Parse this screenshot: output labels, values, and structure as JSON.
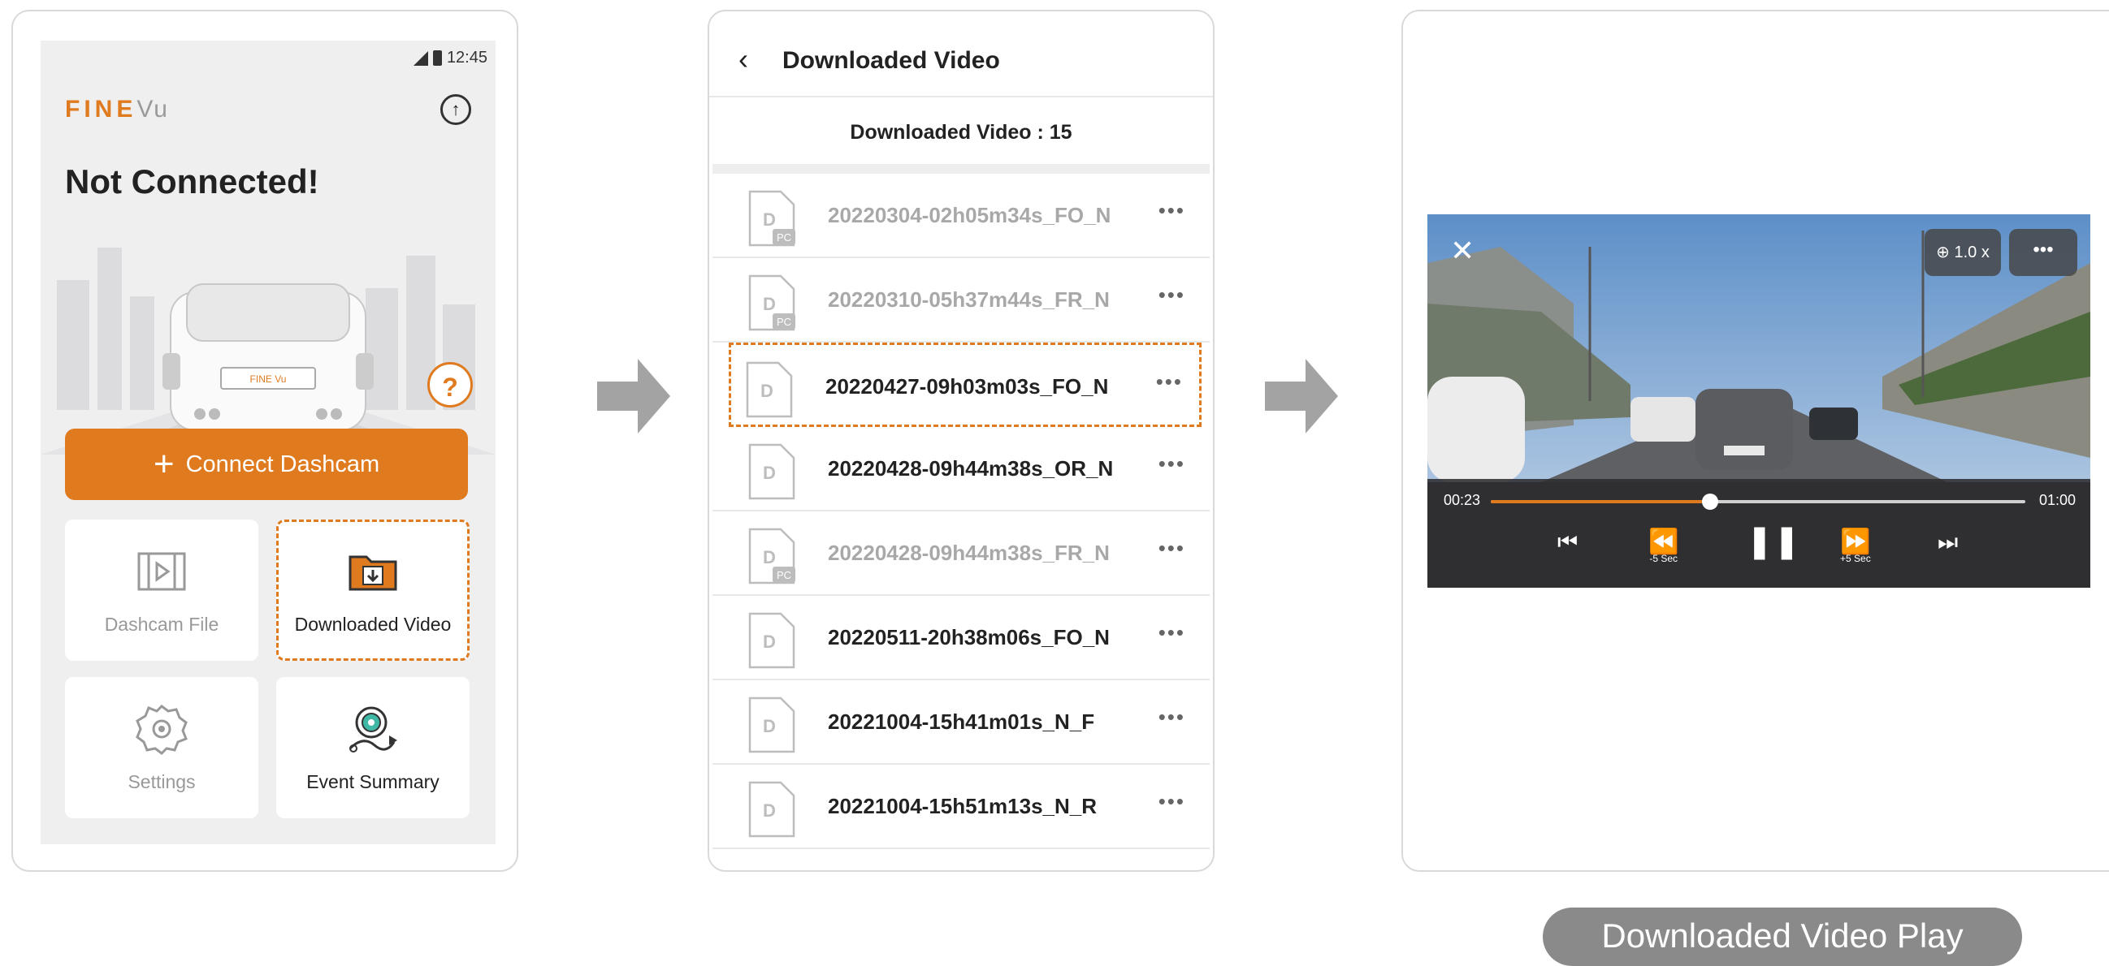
{
  "home": {
    "status_time": "12:45",
    "logo_fine": "FINE",
    "logo_vu": "Vu",
    "heading": "Not Connected!",
    "help_label": "?",
    "connect_label": "Connect Dashcam",
    "cards": {
      "dashcam_file": "Dashcam File",
      "downloaded_video": "Downloaded Video",
      "settings": "Settings",
      "event_summary": "Event Summary"
    }
  },
  "list": {
    "title": "Downloaded Video",
    "count_label": "Downloaded Video : 15",
    "file_badge_letter": "D",
    "pc_badge": "PC",
    "more_label": "•••",
    "items": [
      {
        "name": "20220304-02h05m34s_FO_N",
        "pc": true
      },
      {
        "name": "20220310-05h37m44s_FR_N",
        "pc": true
      },
      {
        "name": "20220427-09h03m03s_FO_N",
        "pc": false,
        "selected": true
      },
      {
        "name": "20220428-09h44m38s_OR_N",
        "pc": false
      },
      {
        "name": "20220428-09h44m38s_FR_N",
        "pc": true
      },
      {
        "name": "20220511-20h38m06s_FO_N",
        "pc": false
      },
      {
        "name": "20221004-15h41m01s_N_F",
        "pc": false
      },
      {
        "name": "20221004-15h51m13s_N_R",
        "pc": false
      }
    ]
  },
  "player": {
    "zoom_label": "1.0 x",
    "more_label": "•••",
    "current_time": "00:23",
    "total_time": "01:00",
    "progress": 0.41,
    "rewind_label": "-5 Sec",
    "forward_label": "+5 Sec"
  },
  "caption": "Downloaded Video Play",
  "colors": {
    "accent": "#e07a1f",
    "muted": "#a8a8a8"
  }
}
